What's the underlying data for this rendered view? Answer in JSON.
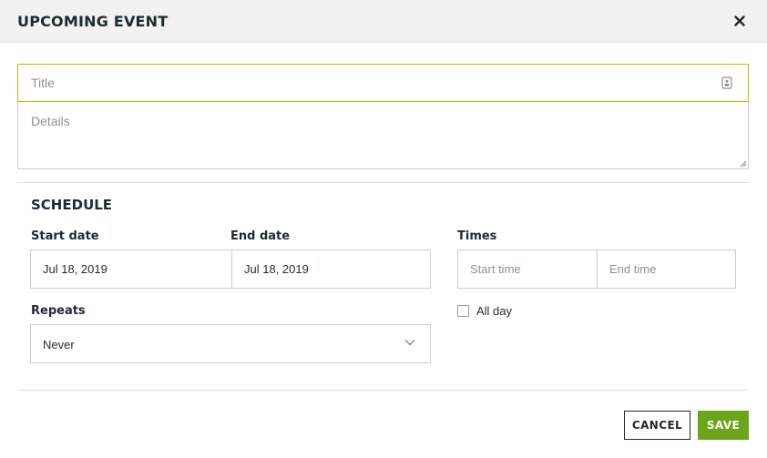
{
  "dialog": {
    "title": "UPCOMING EVENT",
    "close_icon": "close-icon"
  },
  "form": {
    "title_placeholder": "Title",
    "title_value": "",
    "details_placeholder": "Details",
    "details_value": ""
  },
  "schedule": {
    "heading": "SCHEDULE",
    "start_date_label": "Start date",
    "start_date_value": "Jul 18, 2019",
    "end_date_label": "End date",
    "end_date_value": "Jul 18, 2019",
    "times_label": "Times",
    "start_time_placeholder": "Start time",
    "end_time_placeholder": "End time",
    "repeats_label": "Repeats",
    "repeats_value": "Never",
    "all_day_label": "All day",
    "all_day_checked": false
  },
  "actions": {
    "cancel_label": "CANCEL",
    "save_label": "SAVE"
  },
  "colors": {
    "header_bg": "#f1f1f1",
    "focus_border": "#d4b100",
    "save_bg": "#6aa51b",
    "text_dark": "#1f2a30"
  }
}
